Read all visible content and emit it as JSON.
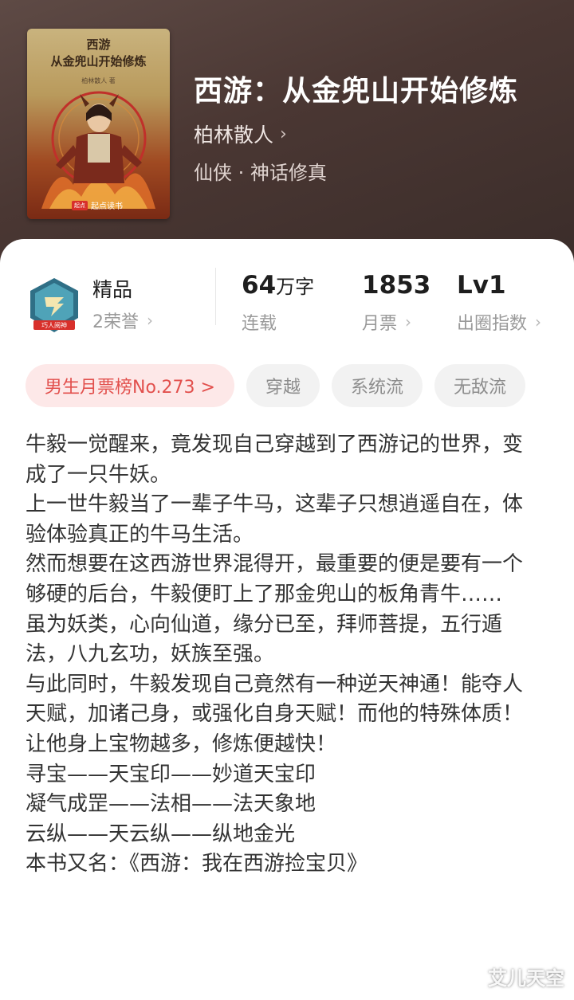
{
  "cover": {
    "title_line1": "西游",
    "title_line2": "从金兜山开始修炼",
    "author_small": "柏林散人 著",
    "brand_mark": "起点",
    "brand": "起点读书"
  },
  "book": {
    "title": "西游：从金兜山开始修炼",
    "author": "柏林散人",
    "genre": "仙侠 · 神话修真"
  },
  "stats": {
    "badge_caption": "巧人阅神",
    "quality": "精品",
    "honors": "2荣誉",
    "words_value": "64",
    "words_unit": "万字",
    "status": "连载",
    "monthly_votes": "1853",
    "monthly_label": "月票",
    "level": "Lv1",
    "level_label": "出圈指数"
  },
  "tags": [
    "男生月票榜No.273 >",
    "穿越",
    "系统流",
    "无敌流"
  ],
  "synopsis": [
    "牛毅一觉醒来，竟发现自己穿越到了西游记的世界，变成了一只牛妖。",
    "上一世牛毅当了一辈子牛马，这辈子只想逍遥自在，体验体验真正的牛马生活。",
    "然而想要在这西游世界混得开，最重要的便是要有一个够硬的后台，牛毅便盯上了那金兜山的板角青牛……",
    "虽为妖类，心向仙道，缘分已至，拜师菩提，五行遁法，八九玄功，妖族至强。",
    "与此同时，牛毅发现自己竟然有一种逆天神通！能夺人天赋，加诸己身，或强化自身天赋！而他的特殊体质！让他身上宝物越多，修炼便越快！",
    "寻宝——天宝印——妙道天宝印",
    "凝气成罡——法相——法天象地",
    "云纵——天云纵——纵地金光",
    "本书又名：《西游：我在西游捡宝贝》"
  ],
  "watermark": "艾儿天空",
  "colors": {
    "hero_bg": "#4a3733",
    "rank_tag_text": "#e2504d",
    "rank_tag_bg": "#fde8e8",
    "tag_bg": "#f2f2f2"
  }
}
